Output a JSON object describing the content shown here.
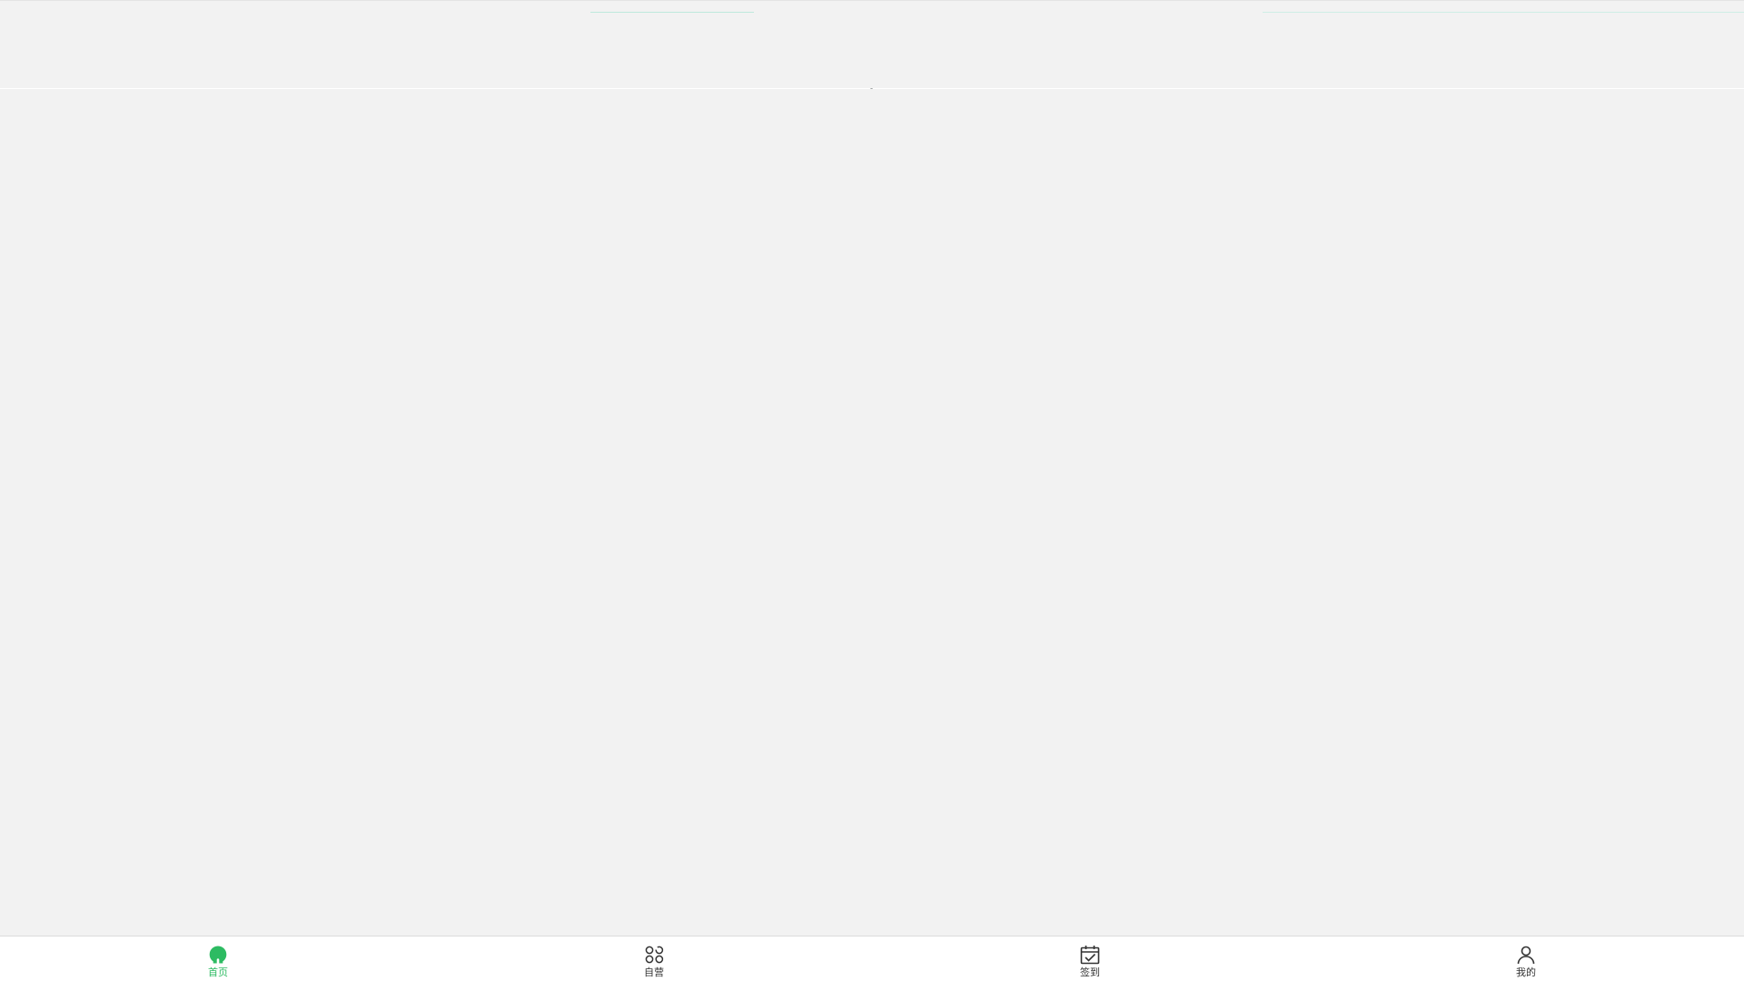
{
  "colors": {
    "active": "#2dbb62",
    "inactive": "#333333",
    "background": "#f2f2f2",
    "tabbar_bg": "#ffffff"
  },
  "tabbar": {
    "items": [
      {
        "label": "首页",
        "icon": "home-icon",
        "active": true
      },
      {
        "label": "自营",
        "icon": "apps-icon",
        "active": false
      },
      {
        "label": "签到",
        "icon": "calendar-check-icon",
        "active": false
      },
      {
        "label": "我的",
        "icon": "user-icon",
        "active": false
      }
    ]
  }
}
